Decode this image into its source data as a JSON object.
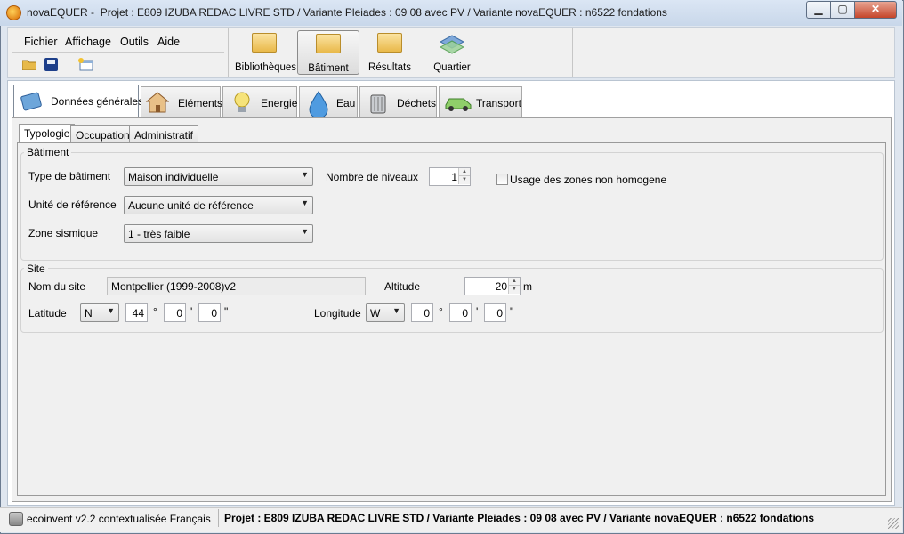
{
  "window": {
    "app_name": "novaEQUER -",
    "title_rest": "Projet : E809 IZUBA REDAC LIVRE STD / Variante Pleiades : 09 08 avec PV / Variante novaEQUER : n6522 fondations",
    "min_glyph": "▁",
    "max_glyph": "▢",
    "close_glyph": "✕"
  },
  "menubar": [
    "Fichier",
    "Affichage",
    "Outils",
    "Aide"
  ],
  "toolbar": {
    "bibliotheques": "Bibliothèques",
    "batiment": "Bâtiment",
    "resultats": "Résultats",
    "quartier": "Quartier"
  },
  "main_tabs": [
    "Données générales",
    "Eléments",
    "Energie",
    "Eau",
    "Déchets",
    "Transport"
  ],
  "sub_tabs": [
    "Typologie",
    "Occupation",
    "Administratif"
  ],
  "batiment": {
    "title": "Bâtiment",
    "type_label": "Type de bâtiment",
    "type_value": "Maison individuelle",
    "unite_label": "Unité de référence",
    "unite_value": "Aucune unité de référence",
    "zone_label": "Zone sismique",
    "zone_value": "1 - très faible",
    "niveaux_label": "Nombre de niveaux",
    "niveaux_value": "1",
    "usage_label": "Usage des zones non homogene",
    "usage_checked": false
  },
  "site": {
    "title": "Site",
    "nom_label": "Nom du site",
    "nom_value": "Montpellier (1999-2008)v2",
    "altitude_label": "Altitude",
    "altitude_value": "20",
    "altitude_unit": "m",
    "latitude_label": "Latitude",
    "lat_dir": "N",
    "lat_deg": "44",
    "lat_min": "0",
    "lat_sec": "0",
    "longitude_label": "Longitude",
    "lon_dir": "W",
    "lon_deg": "0",
    "lon_min": "0",
    "lon_sec": "0",
    "deg_symbol": "°",
    "min_symbol": "'",
    "sec_symbol": "\""
  },
  "status": {
    "left": "ecoinvent v2.2 contextualisée Français",
    "right": "Projet : E809 IZUBA REDAC LIVRE STD / Variante Pleiades : 09 08 avec PV / Variante novaEQUER : n6522 fondations"
  },
  "combo_arrow": "▼",
  "spin_up": "▲",
  "spin_down": "▼"
}
